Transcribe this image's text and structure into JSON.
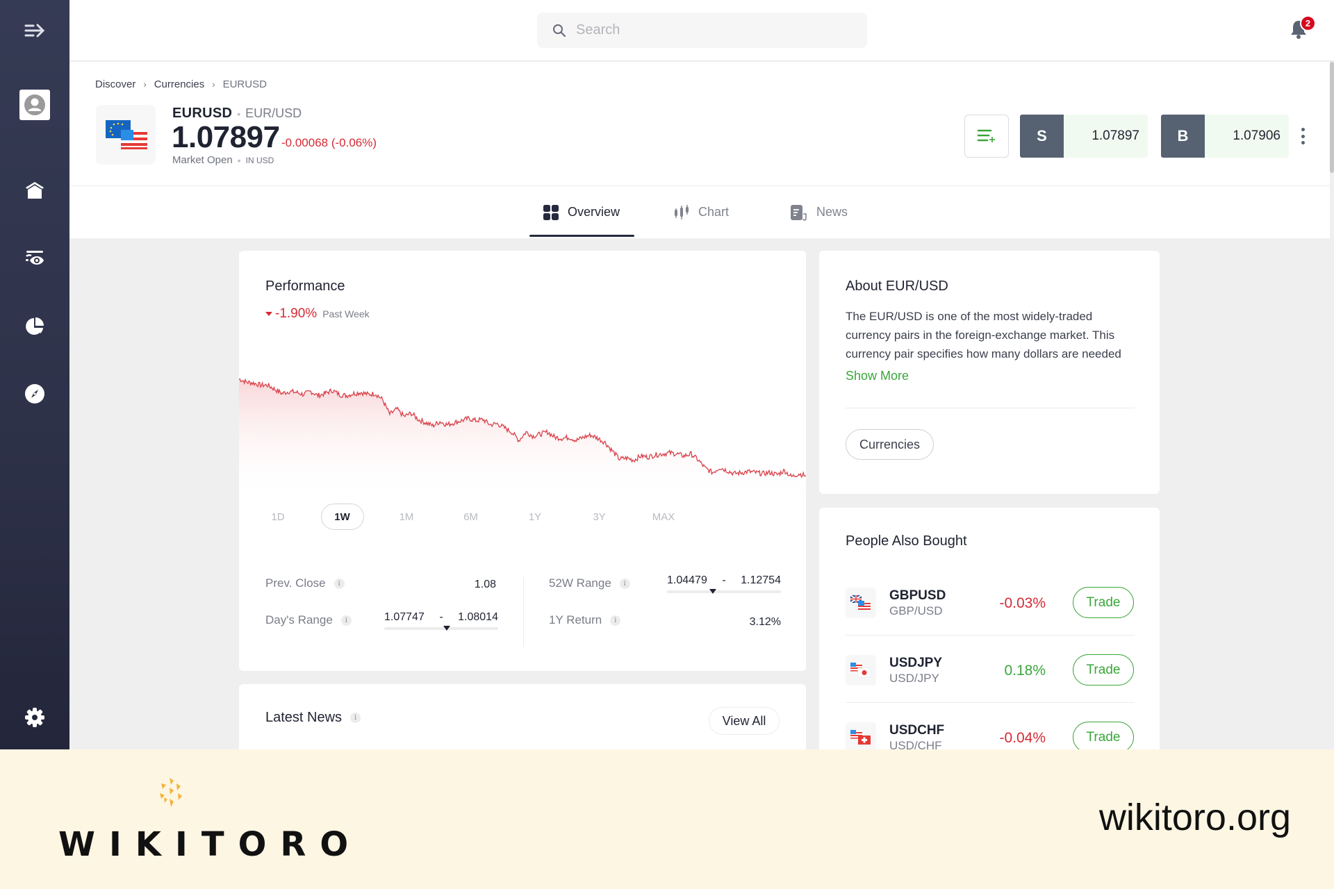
{
  "sidebar": {
    "items": [
      {
        "name": "collapse-menu",
        "icon": "expand-arrow-icon"
      },
      {
        "name": "profile",
        "icon": "user-avatar-icon"
      },
      {
        "name": "home",
        "icon": "home-icon"
      },
      {
        "name": "watchlist",
        "icon": "watchlist-eye-icon"
      },
      {
        "name": "portfolio",
        "icon": "pie-chart-icon"
      },
      {
        "name": "discover",
        "icon": "compass-icon"
      },
      {
        "name": "settings",
        "icon": "gear-icon"
      }
    ]
  },
  "topbar": {
    "search_placeholder": "Search",
    "notifications_count": "2"
  },
  "breadcrumb": [
    "Discover",
    "Currencies",
    "EURUSD"
  ],
  "instrument": {
    "symbol": "EURUSD",
    "name": "EUR/USD",
    "price": "1.07897",
    "change": "-0.00068 (-0.06%)",
    "status": "Market Open",
    "currency": "IN USD",
    "sell_label": "S",
    "sell_price": "1.07897",
    "buy_label": "B",
    "buy_price": "1.07906"
  },
  "tabs": [
    {
      "label": "Overview",
      "icon": "grid-icon",
      "active": true
    },
    {
      "label": "Chart",
      "icon": "candlestick-icon",
      "active": false
    },
    {
      "label": "News",
      "icon": "news-icon",
      "active": false
    }
  ],
  "performance": {
    "title": "Performance",
    "change": "-1.90%",
    "period_label": "Past Week",
    "periods": [
      "1D",
      "1W",
      "1M",
      "6M",
      "1Y",
      "3Y",
      "MAX"
    ],
    "active_period": "1W",
    "stats": {
      "prev_close_label": "Prev. Close",
      "prev_close": "1.08",
      "days_range_label": "Day's Range",
      "days_range_low": "1.07747",
      "days_range_high": "1.08014",
      "days_range_sep": "-",
      "days_range_position": 0.55,
      "w52_range_label": "52W Range",
      "w52_range_low": "1.04479",
      "w52_range_high": "1.12754",
      "w52_range_sep": "-",
      "w52_range_position": 0.4,
      "return_1y_label": "1Y Return",
      "return_1y": "3.12%"
    }
  },
  "chart_data": {
    "type": "area",
    "title": "Performance",
    "xlabel": "",
    "ylabel": "",
    "series": [
      {
        "name": "EURUSD 1W",
        "color": "#d8414a",
        "values": [
          1.0997,
          1.0994,
          1.0993,
          1.0991,
          1.0991,
          1.0987,
          1.0983,
          1.0985,
          1.0984,
          1.0982,
          1.0985,
          1.0981,
          1.0983,
          1.0986,
          1.0982,
          1.0981,
          1.0983,
          1.0984,
          1.0982,
          1.0983,
          1.0977,
          1.0963,
          1.0968,
          1.0961,
          1.0964,
          1.0958,
          1.0955,
          1.0952,
          1.0956,
          1.0953,
          1.0955,
          1.0957,
          1.0959,
          1.0957,
          1.0958,
          1.0953,
          1.0954,
          1.095,
          1.0946,
          1.0938,
          1.0946,
          1.0942,
          1.0944,
          1.0946,
          1.0941,
          1.094,
          1.0941,
          1.0938,
          1.0941,
          1.0943,
          1.094,
          1.0936,
          1.0928,
          1.092,
          1.0921,
          1.0919,
          1.0923,
          1.0922,
          1.0924,
          1.0925,
          1.0926,
          1.0925,
          1.0923,
          1.0925,
          1.0919,
          1.0911,
          1.0907,
          1.0912,
          1.0909,
          1.0906,
          1.0907,
          1.0908,
          1.0907,
          1.0906,
          1.0907,
          1.0905,
          1.0909,
          1.0903,
          1.0906,
          1.0904
        ]
      }
    ],
    "xlim": [
      0,
      79
    ],
    "ylim": [
      1.088,
      1.104
    ],
    "grid": false,
    "legend": "none"
  },
  "about": {
    "title": "About EUR/USD",
    "text": "The EUR/USD is one of the most widely-traded currency pairs in the foreign-exchange market. This currency pair specifies how many dollars are needed",
    "show_more": "Show More",
    "tag": "Currencies"
  },
  "people_also_bought": {
    "title": "People Also Bought",
    "items": [
      {
        "symbol": "GBPUSD",
        "name": "GBP/USD",
        "change": "-0.03%",
        "direction": "down",
        "button": "Trade"
      },
      {
        "symbol": "USDJPY",
        "name": "USD/JPY",
        "change": "0.18%",
        "direction": "up",
        "button": "Trade"
      },
      {
        "symbol": "USDCHF",
        "name": "USD/CHF",
        "change": "-0.04%",
        "direction": "down",
        "button": "Trade"
      }
    ]
  },
  "news": {
    "title": "Latest News",
    "view_all": "View All"
  },
  "watermark": {
    "brand": "WIKITORO",
    "url": "wikitoro.org"
  },
  "colors": {
    "negative": "#d42b35",
    "positive": "#3aa63a",
    "sidebar": "#2d3148",
    "price_button": "#566271"
  }
}
